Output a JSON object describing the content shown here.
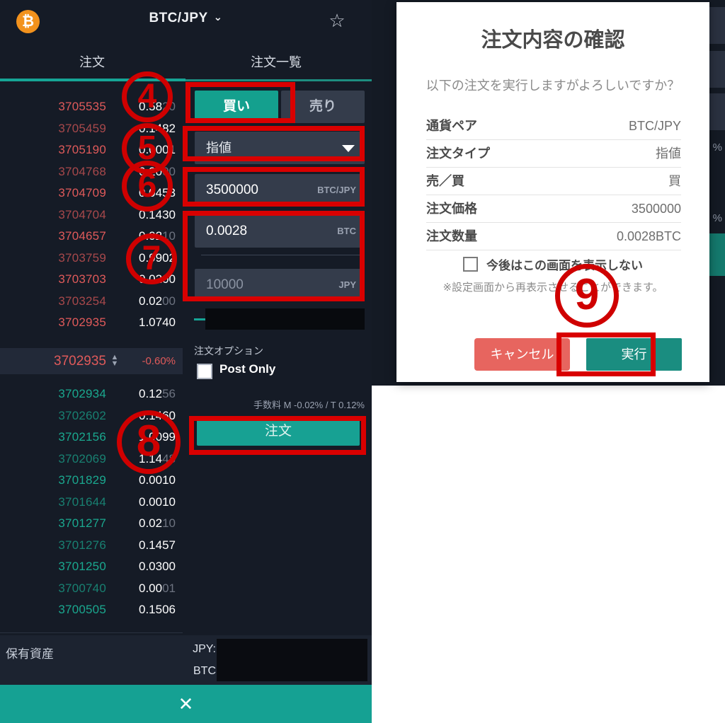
{
  "left": {
    "header": {
      "logo_icon": "bitcoin-icon",
      "logo_glyph": "₿",
      "pair": "BTC/JPY",
      "chevron_glyph": "⌄",
      "star_icon": "star-outline-icon",
      "star_glyph": "☆"
    },
    "tabs": [
      {
        "label": "注文",
        "active": true
      },
      {
        "label": "注文一覧",
        "active": false
      }
    ],
    "orderbook": {
      "asks": [
        {
          "price": "3705535",
          "amount": "0.5820"
        },
        {
          "price": "3705459",
          "amount": "0.1482"
        },
        {
          "price": "3705190",
          "amount": "0.0001"
        },
        {
          "price": "3704768",
          "amount": "0.2000"
        },
        {
          "price": "3704709",
          "amount": "0.0453"
        },
        {
          "price": "3704704",
          "amount": "0.1430"
        },
        {
          "price": "3704657",
          "amount": "0.0210"
        },
        {
          "price": "3703759",
          "amount": "0.9902"
        },
        {
          "price": "3703703",
          "amount": "0.0200"
        },
        {
          "price": "3703254",
          "amount": "0.0200"
        },
        {
          "price": "3702935",
          "amount": "1.0740"
        }
      ],
      "mid": {
        "price": "3702935",
        "change_pct": "-0.60%",
        "arrows_glyph": "▲▼"
      },
      "bids": [
        {
          "price": "3702934",
          "amount": "0.1256"
        },
        {
          "price": "3702602",
          "amount": "0.1460"
        },
        {
          "price": "3702156",
          "amount": "1.0099"
        },
        {
          "price": "3702069",
          "amount": "1.1448"
        },
        {
          "price": "3701829",
          "amount": "0.0010"
        },
        {
          "price": "3701644",
          "amount": "0.0010"
        },
        {
          "price": "3701277",
          "amount": "0.0210"
        },
        {
          "price": "3701276",
          "amount": "0.1457"
        },
        {
          "price": "3701250",
          "amount": "0.0300"
        },
        {
          "price": "3700740",
          "amount": "0.0001"
        },
        {
          "price": "3700505",
          "amount": "0.1506"
        }
      ]
    },
    "form": {
      "buy_label": "買い",
      "sell_label": "売り",
      "order_type": "指値",
      "price_value": "3500000",
      "price_unit": "BTC/JPY",
      "amount_value": "0.0028",
      "amount_unit": "BTC",
      "jpy_placeholder": "10000",
      "jpy_unit": "JPY",
      "options_title": "注文オプション",
      "post_only_label": "Post Only",
      "fee_text": "手数料 M -0.02% / T 0.12%",
      "submit_label": "注文"
    },
    "holdings": {
      "title": "保有資産",
      "jpy_label": "JPY:",
      "btc_label": "BTC"
    },
    "bottom": {
      "close_glyph": "✕",
      "close_name": "close-icon"
    }
  },
  "modal": {
    "title": "注文内容の確認",
    "subtitle": "以下の注文を実行しますがよろしいですか？",
    "rows": [
      {
        "label": "通貨ペア",
        "value": "BTC/JPY"
      },
      {
        "label": "注文タイプ",
        "value": "指値"
      },
      {
        "label": "売／買",
        "value": "買"
      },
      {
        "label": "注文価格",
        "value": "3500000"
      },
      {
        "label": "注文数量",
        "value": "0.0028BTC"
      }
    ],
    "checkbox_label": "今後はこの画面を表示しない",
    "note": "※設定画面から再表示させることができます。",
    "cancel_label": "キャンセル",
    "execute_label": "実行"
  },
  "background_peek": {
    "pct_1": "%",
    "pct_2": "%"
  },
  "annotations": {
    "highlight_color": "#d90000",
    "steps": [
      {
        "n": "4"
      },
      {
        "n": "5"
      },
      {
        "n": "6"
      },
      {
        "n": "7"
      },
      {
        "n": "8"
      },
      {
        "n": "9"
      }
    ]
  }
}
